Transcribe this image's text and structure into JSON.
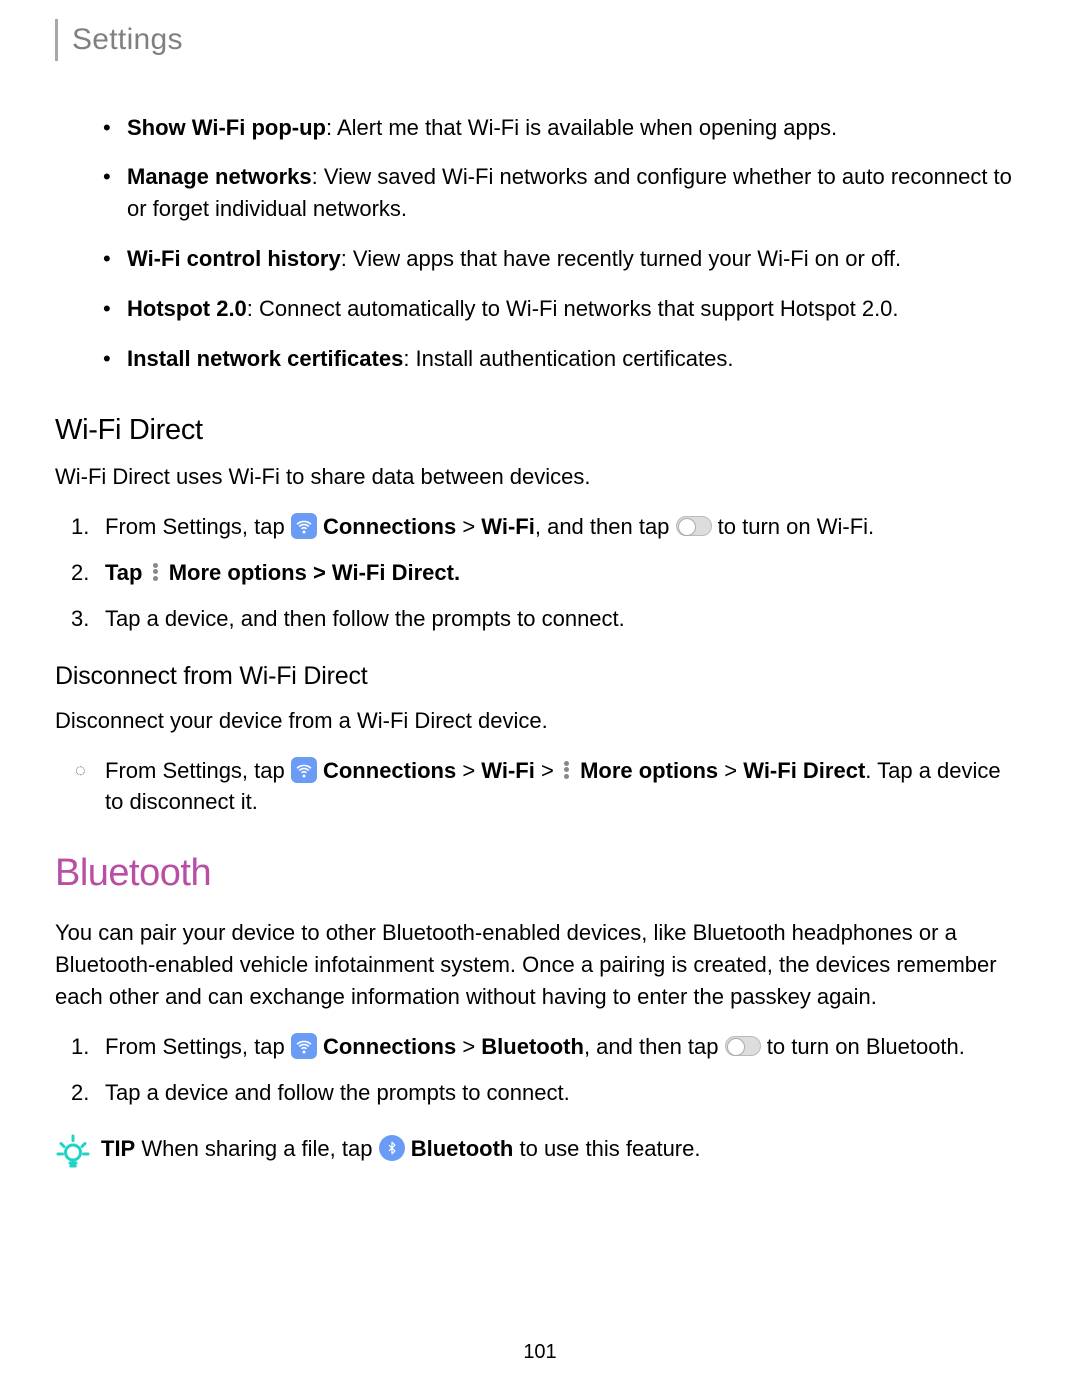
{
  "header": {
    "title": "Settings"
  },
  "bullets": [
    {
      "term": "Show Wi-Fi pop-up",
      "desc": ": Alert me that Wi-Fi is available when opening apps."
    },
    {
      "term": "Manage networks",
      "desc": ": View saved Wi-Fi networks and configure whether to auto reconnect to or forget individual networks."
    },
    {
      "term": "Wi-Fi control history",
      "desc": ": View apps that have recently turned your Wi-Fi on or off."
    },
    {
      "term": "Hotspot 2.0",
      "desc": ": Connect automatically to Wi-Fi networks that support Hotspot 2.0."
    },
    {
      "term": "Install network certificates",
      "desc": ": Install authentication certificates."
    }
  ],
  "wifidirect": {
    "heading": "Wi-Fi Direct",
    "intro": "Wi-Fi Direct uses Wi-Fi to share data between devices.",
    "step1_pre": "From Settings, tap ",
    "step1_conn": " Connections",
    "step1_mid": " > ",
    "step1_wifi": "Wi-Fi",
    "step1_mid2": ", and then tap ",
    "step1_end": " to turn on Wi-Fi.",
    "step2_pre": "Tap ",
    "step2_more": " More options",
    "step2_mid": " > ",
    "step2_wd": "Wi-Fi Direct",
    "step2_end": ".",
    "step3": "Tap a device, and then follow the prompts to connect."
  },
  "disconnect": {
    "heading": "Disconnect from Wi-Fi Direct",
    "intro": "Disconnect your device from a Wi-Fi Direct device.",
    "item_pre": "From Settings, tap ",
    "conn": " Connections",
    "sep": " > ",
    "wifi": "Wi-Fi",
    "more": " More options",
    "wd": "Wi-Fi Direct",
    "end": ". Tap a device to disconnect it."
  },
  "bluetooth": {
    "heading": "Bluetooth",
    "intro": "You can pair your device to other Bluetooth-enabled devices, like Bluetooth headphones or a Bluetooth-enabled vehicle infotainment system. Once a pairing is created, the devices remember each other and can exchange information without having to enter the passkey again.",
    "step1_pre": "From Settings, tap ",
    "step1_conn": " Connections",
    "step1_mid": " > ",
    "step1_bt": "Bluetooth",
    "step1_mid2": ", and then tap ",
    "step1_end": " to turn on Bluetooth.",
    "step2": "Tap a device and follow the prompts to connect.",
    "tip_label": "TIP",
    "tip_pre": " When sharing a file, tap ",
    "tip_bt": " Bluetooth",
    "tip_end": " to use this feature."
  },
  "page": "101"
}
